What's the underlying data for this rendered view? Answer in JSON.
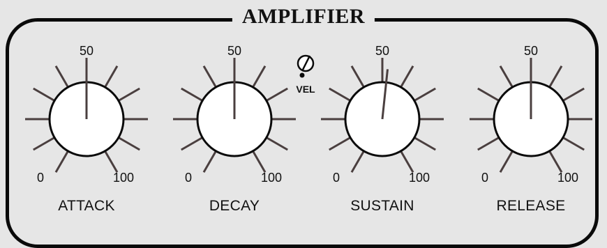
{
  "section": {
    "title": "AMPLIFIER"
  },
  "vel_label": "VEL",
  "knobs": [
    {
      "name": "ATTACK",
      "min_label": "0",
      "mid_label": "50",
      "max_label": "100",
      "value": 50
    },
    {
      "name": "DECAY",
      "min_label": "0",
      "mid_label": "50",
      "max_label": "100",
      "value": 50
    },
    {
      "name": "SUSTAIN",
      "min_label": "0",
      "mid_label": "50",
      "max_label": "100",
      "value": 52
    },
    {
      "name": "RELEASE",
      "min_label": "0",
      "mid_label": "50",
      "max_label": "100",
      "value": 50
    }
  ],
  "colors": {
    "background": "#e6e6e6",
    "ink": "#111111",
    "tick": "#4a3f3f"
  }
}
